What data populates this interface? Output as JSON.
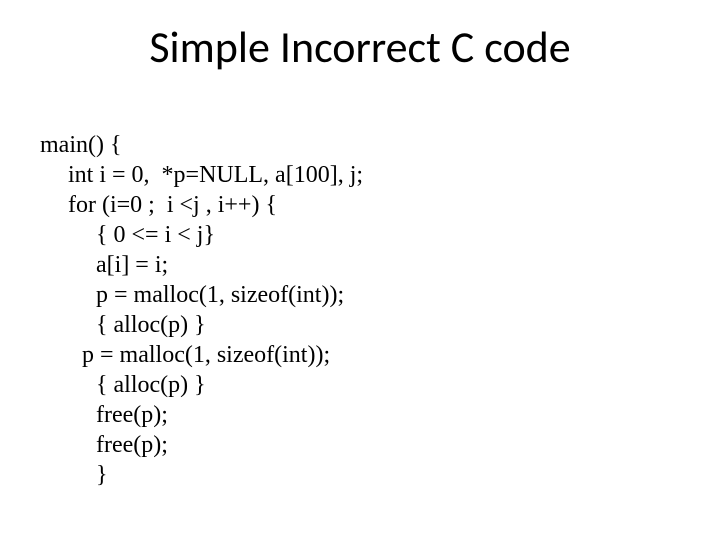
{
  "title": "Simple Incorrect C code",
  "code": {
    "l0": "main() {",
    "l1": "int i = 0,  *p=NULL, a[100], j;",
    "l2": "for (i=0 ;  i <j , i++) {",
    "l3": "{ 0 <= i < j}",
    "l4": "a[i] = i;",
    "l5": "p = malloc(1, sizeof(int));",
    "l6": "{ alloc(p) }",
    "l7": "p = malloc(1, sizeof(int));",
    "l8": "{ alloc(p) }",
    "l9": "free(p);",
    "l10": "free(p);",
    "l11": "}"
  }
}
